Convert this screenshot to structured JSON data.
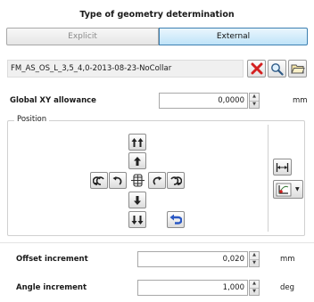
{
  "title": "Type of geometry determination",
  "mode_tabs": {
    "explicit": "Explicit",
    "external": "External"
  },
  "file": {
    "value": "FM_AS_OS_L_3,5_4,0-2013-08-23-NoCollar"
  },
  "icons": {
    "delete": "red-x-icon",
    "search": "magnifier-icon",
    "open": "folder-open-icon"
  },
  "global_xy": {
    "label": "Global XY allowance",
    "value": "0,0000",
    "unit": "mm"
  },
  "position": {
    "label": "Position"
  },
  "offset_increment": {
    "label": "Offset increment",
    "value": "0,020",
    "unit": "mm"
  },
  "angle_increment": {
    "label": "Angle increment",
    "value": "1,000",
    "unit": "deg"
  },
  "colors": {
    "accent": "#3c7fb1",
    "delete": "#d42020",
    "undo": "#2a58c4"
  }
}
